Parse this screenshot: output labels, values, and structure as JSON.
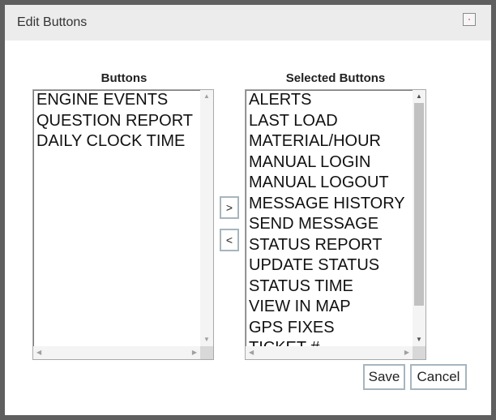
{
  "dialog": {
    "title": "Edit Buttons",
    "close_icon": "close-icon",
    "close_color": "#cc0000"
  },
  "available": {
    "label": "Buttons",
    "items": [
      "ENGINE EVENTS",
      "QUESTION REPORT",
      "DAILY CLOCK TIME"
    ]
  },
  "selected": {
    "label": "Selected Buttons",
    "items": [
      "ALERTS",
      "LAST LOAD",
      "MATERIAL/HOUR",
      "MANUAL LOGIN",
      "MANUAL LOGOUT",
      "MESSAGE HISTORY",
      "SEND MESSAGE",
      "STATUS REPORT",
      "UPDATE STATUS",
      "STATUS TIME",
      "VIEW IN MAP",
      "GPS FIXES",
      "TICKET #"
    ]
  },
  "controls": {
    "add_label": ">",
    "remove_label": "<"
  },
  "actions": {
    "save_label": "Save",
    "cancel_label": "Cancel"
  }
}
